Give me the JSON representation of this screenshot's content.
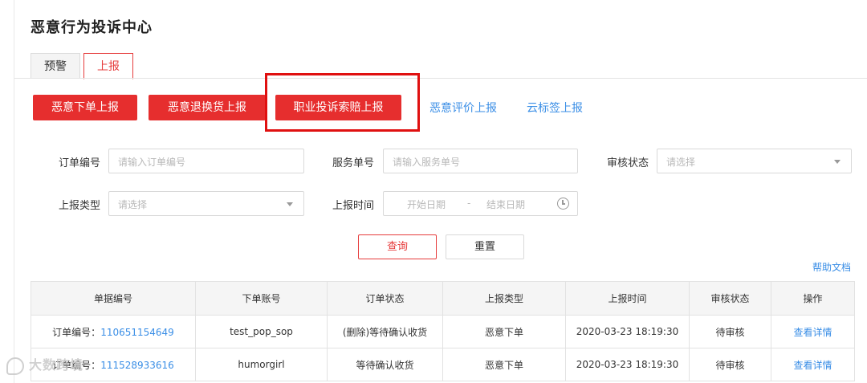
{
  "page": {
    "title": "恶意行为投诉中心"
  },
  "tabs": [
    {
      "label": "预警"
    },
    {
      "label": "上报"
    }
  ],
  "report_buttons": [
    {
      "label": "恶意下单上报"
    },
    {
      "label": "恶意退换货上报"
    },
    {
      "label": "职业投诉索赔上报"
    }
  ],
  "report_links": [
    {
      "label": "恶意评价上报"
    },
    {
      "label": "云标签上报"
    }
  ],
  "filters": {
    "order_no": {
      "label": "订单编号",
      "placeholder": "请输入订单编号"
    },
    "service_no": {
      "label": "服务单号",
      "placeholder": "请输入服务单号"
    },
    "review_status": {
      "label": "审核状态",
      "placeholder": "请选择"
    },
    "report_type": {
      "label": "上报类型",
      "placeholder": "请选择"
    },
    "report_time": {
      "label": "上报时间",
      "start_placeholder": "开始日期",
      "separator": "-",
      "end_placeholder": "结束日期"
    }
  },
  "actions": {
    "query_label": "查询",
    "reset_label": "重置",
    "help_label": "帮助文档"
  },
  "table": {
    "columns": [
      "单据编号",
      "下单账号",
      "订单状态",
      "上报类型",
      "上报时间",
      "审核状态",
      "操作"
    ],
    "rows": [
      {
        "doc_prefix": "订单编号：",
        "doc_no": "110651154649",
        "account": "test_pop_sop",
        "order_status": "(删除)等待确认收货",
        "report_type": "恶意下单",
        "report_time": "2020-03-23 18:19:30",
        "review_status": "待审核",
        "action": "查看详情"
      },
      {
        "doc_prefix": "订单编号：",
        "doc_no": "111528933616",
        "account": "humorgirl",
        "order_status": "等待确认收货",
        "report_type": "恶意下单",
        "report_time": "2020-03-23 18:19:30",
        "review_status": "待审核",
        "action": "查看详情"
      }
    ]
  },
  "watermark": {
    "text": "大数跨境"
  },
  "colors": {
    "accent": "#e62e2e",
    "link": "#3a8ee6",
    "highlight_box": "#e01010"
  }
}
